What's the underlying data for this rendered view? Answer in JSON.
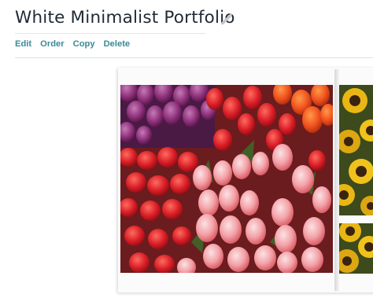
{
  "portfolio": {
    "title": "White Minimalist Portfolio",
    "edit_icon": "pencil-icon"
  },
  "toolbar": {
    "edit_label": "Edit",
    "order_label": "Order",
    "copy_label": "Copy",
    "delete_label": "Delete"
  },
  "photos": [
    {
      "subject": "tulips"
    },
    {
      "subject": "sunflowers"
    }
  ],
  "colors": {
    "title": "#1f2a36",
    "action_link": "#3b8a96",
    "divider": "#dde1e5"
  }
}
